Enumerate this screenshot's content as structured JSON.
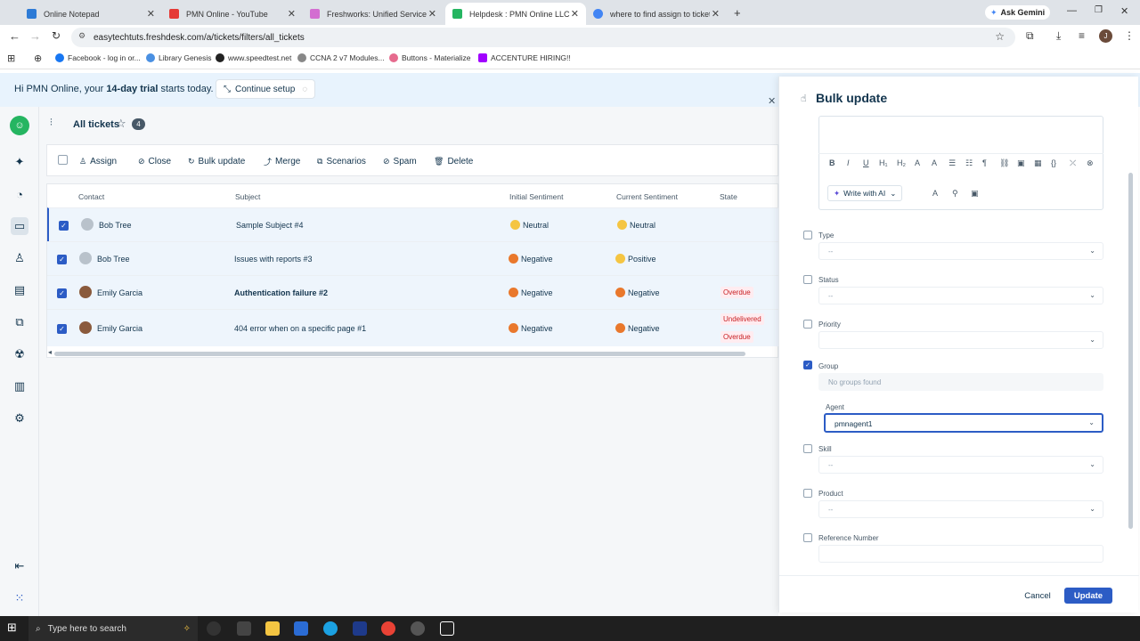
{
  "browser": {
    "tabs": [
      {
        "label": "Online Notepad",
        "color": "#2e7bd6"
      },
      {
        "label": "PMN Online - YouTube",
        "color": "#e53935"
      },
      {
        "label": "Freshworks: Unified Service Op",
        "color": "#d36ed1"
      },
      {
        "label": "Helpdesk : PMN Online LLC",
        "color": "#25b561"
      },
      {
        "label": "where to find assign to ticket fr",
        "color": "#4285f4"
      }
    ],
    "ask_gemini": "Ask Gemini",
    "url": "easytechtuts.freshdesk.com/a/tickets/filters/all_tickets",
    "bookmarks": [
      "Facebook - log in or...",
      "Library Genesis",
      "www.speedtest.net",
      "CCNA 2 v7 Modules...",
      "Buttons - Materialize",
      "ACCENTURE HIRING!!"
    ]
  },
  "trial": {
    "text_before": "Hi PMN Online, your ",
    "text_bold": "14-day trial",
    "text_after": " starts today.",
    "setup_label": "Continue setup"
  },
  "view": {
    "title": "All tickets",
    "count": "4"
  },
  "toolbar": {
    "assign": "Assign",
    "close": "Close",
    "bulk_update": "Bulk update",
    "merge": "Merge",
    "scenarios": "Scenarios",
    "spam": "Spam",
    "delete": "Delete"
  },
  "table": {
    "headers": [
      "Contact",
      "Subject",
      "Initial Sentiment",
      "Current Sentiment",
      "State"
    ],
    "rows": [
      {
        "contact": "Bob Tree",
        "subject": "Sample Subject #4",
        "initial": "Neutral",
        "current": "Neutral",
        "state": "",
        "state2": ""
      },
      {
        "contact": "Bob Tree",
        "subject": "Issues with reports #3",
        "initial": "Negative",
        "current": "Positive",
        "state": "",
        "state2": ""
      },
      {
        "contact": "Emily Garcia",
        "subject": "Authentication failure #2",
        "initial": "Negative",
        "current": "Negative",
        "state": "Overdue",
        "state2": ""
      },
      {
        "contact": "Emily Garcia",
        "subject": "404 error when on a specific page #1",
        "initial": "Negative",
        "current": "Negative",
        "state": "Undelivered",
        "state2": "Overdue"
      }
    ]
  },
  "panel": {
    "title": "Bulk update",
    "write_ai": "Write with AI",
    "fields": {
      "type_label": "Type",
      "type_value": "--",
      "status_label": "Status",
      "status_value": "--",
      "priority_label": "Priority",
      "priority_value": "",
      "group_label": "Group",
      "group_value": "No groups found",
      "agent_label": "Agent",
      "agent_value": "pmnagent1",
      "skill_label": "Skill",
      "skill_value": "--",
      "product_label": "Product",
      "product_value": "--",
      "reference_label": "Reference Number"
    },
    "cancel": "Cancel",
    "update": "Update"
  },
  "taskbar": {
    "search_placeholder": "Type here to search"
  }
}
